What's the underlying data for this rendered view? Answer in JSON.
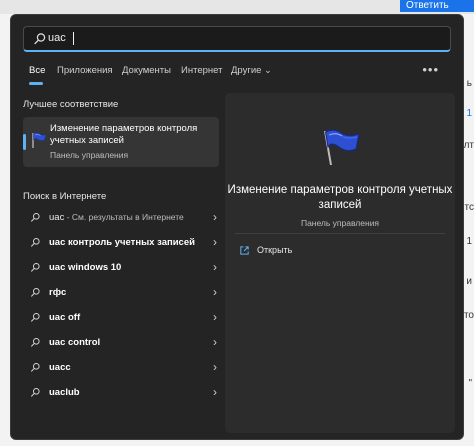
{
  "background": {
    "reply_button": "Ответить",
    "fragments": [
      "ь",
      "1",
      "лт",
      "тс",
      "1",
      "и",
      "то",
      "\""
    ]
  },
  "search": {
    "value": "uac"
  },
  "tabs": {
    "all": "Все",
    "apps": "Приложения",
    "documents": "Документы",
    "internet": "Интернет",
    "other": "Другие",
    "other_chevron": "⌄",
    "more": "•••"
  },
  "best_match": {
    "section_title": "Лучшее соответствие",
    "title": "Изменение параметров контроля учетных записей",
    "subtitle": "Панель управления"
  },
  "web_search": {
    "section_title": "Поиск в Интернете",
    "results": [
      {
        "bold": "uac",
        "rest": " - См. результаты в Интернете"
      },
      {
        "bold": "uac контроль учетных записей",
        "rest": ""
      },
      {
        "bold": "uac windows 10",
        "rest": ""
      },
      {
        "bold": "rфc",
        "rest": ""
      },
      {
        "bold": "uac off",
        "rest": ""
      },
      {
        "bold": "uac control",
        "rest": ""
      },
      {
        "bold": "uacc",
        "rest": ""
      },
      {
        "bold": "uaclub",
        "rest": ""
      }
    ],
    "chevron": "›"
  },
  "details": {
    "title": "Изменение параметров контроля учетных записей",
    "subtitle": "Панель управления",
    "open_label": "Открыть"
  },
  "colors": {
    "accent": "#5fb2f2",
    "panel": "#242424",
    "flag_blue": "#2d4fd1"
  }
}
